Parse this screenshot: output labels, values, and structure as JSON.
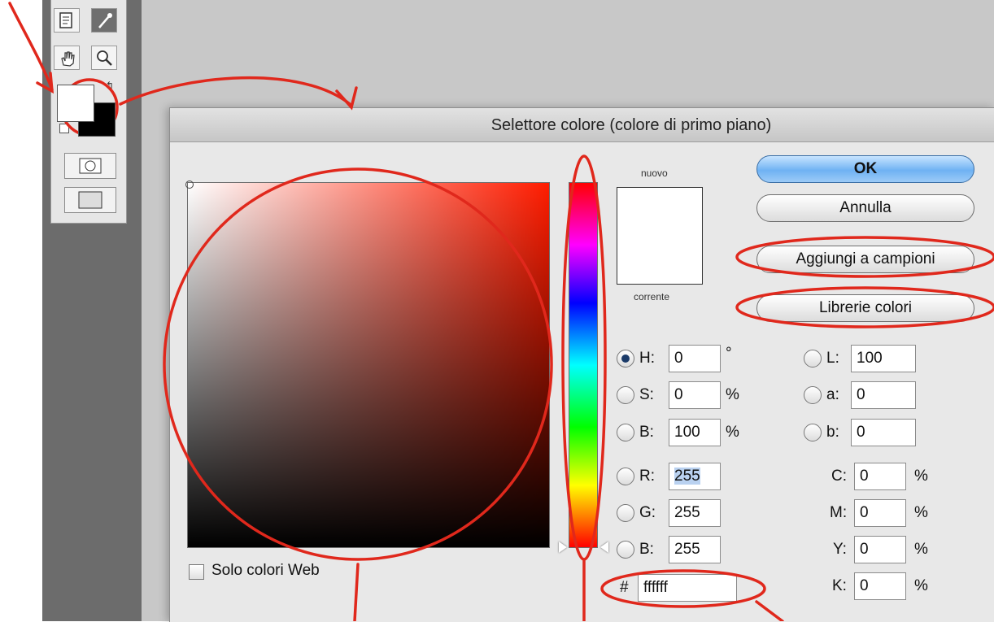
{
  "dialog": {
    "title": "Selettore colore (colore di primo piano)",
    "preview_new_label": "nuovo",
    "preview_current_label": "corrente",
    "preview_color": "#ffffff",
    "buttons": {
      "ok": "OK",
      "cancel": "Annulla",
      "add_to_swatches": "Aggiungi a campioni",
      "color_libraries": "Librerie colori"
    },
    "web_only_label": "Solo colori Web",
    "selected_mode": "H",
    "hsb": {
      "h_label": "H:",
      "h_value": "0",
      "h_unit": "°",
      "s_label": "S:",
      "s_value": "0",
      "s_unit": "%",
      "b_label": "B:",
      "b_value": "100",
      "b_unit": "%"
    },
    "rgb": {
      "r_label": "R:",
      "r_value": "255",
      "g_label": "G:",
      "g_value": "255",
      "b_label": "B:",
      "b_value": "255"
    },
    "hex": {
      "label": "#",
      "value": "ffffff"
    },
    "lab": {
      "l_label": "L:",
      "l_value": "100",
      "a_label": "a:",
      "a_value": "0",
      "b_label": "b:",
      "b_value": "0"
    },
    "cmyk": {
      "c_label": "C:",
      "c_value": "0",
      "m_label": "M:",
      "m_value": "0",
      "y_label": "Y:",
      "y_value": "0",
      "k_label": "K:",
      "k_value": "0",
      "unit": "%"
    }
  },
  "toolbar": {
    "foreground_color": "#ffffff",
    "background_color": "#000000",
    "tools": [
      "notes-icon",
      "eyedropper-icon",
      "hand-icon",
      "zoom-icon"
    ]
  },
  "annotation_color": "#e0281c"
}
